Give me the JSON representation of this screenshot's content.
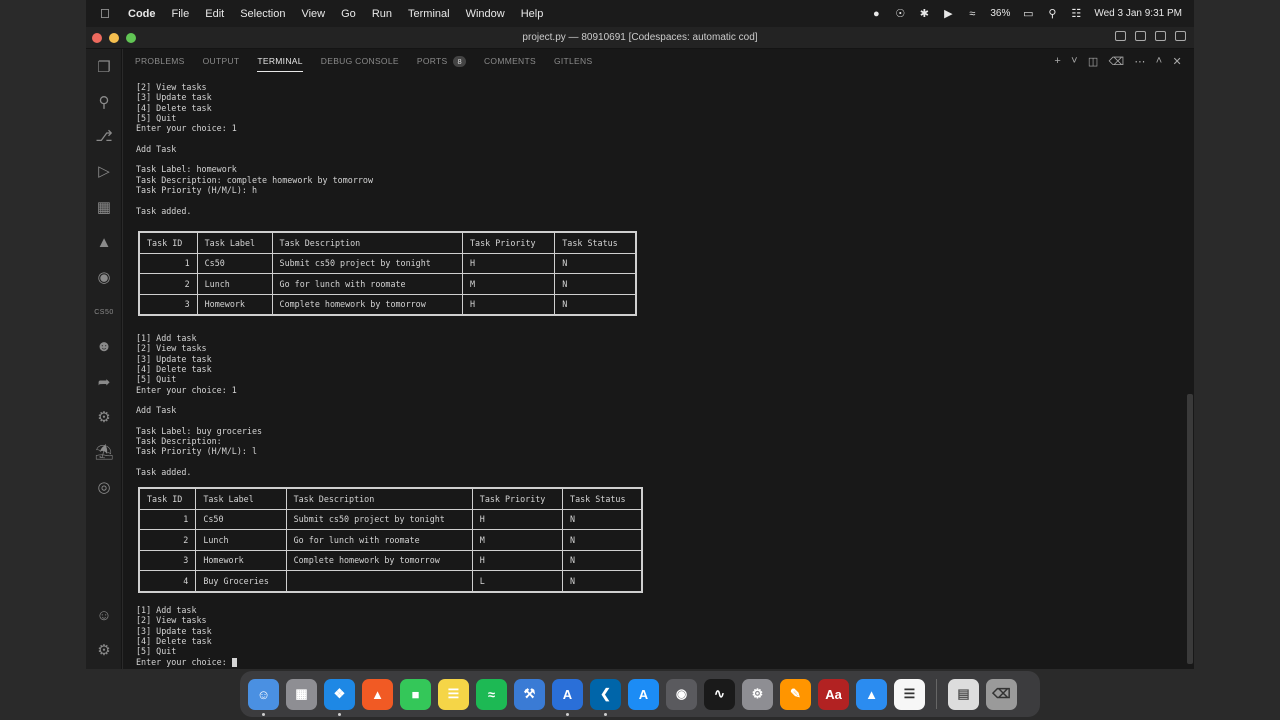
{
  "menubar": {
    "app_name": "Code",
    "menus": [
      "File",
      "Edit",
      "Selection",
      "View",
      "Go",
      "Run",
      "Terminal",
      "Window",
      "Help"
    ],
    "battery": "36%",
    "datetime": "Wed 3 Jan  9:31 PM"
  },
  "window": {
    "title": "project.py — 80910691 [Codespaces: automatic cod]"
  },
  "panel": {
    "tabs": [
      "PROBLEMS",
      "OUTPUT",
      "TERMINAL",
      "DEBUG CONSOLE",
      "PORTS",
      "COMMENTS",
      "GITLENS"
    ],
    "active_tab": "TERMINAL",
    "ports_count": "8"
  },
  "activity_bar": {
    "cs50_label": "CS50"
  },
  "terminal": {
    "block1": [
      "[2] View tasks",
      "[3] Update task",
      "[4] Delete task",
      "[5] Quit",
      "Enter your choice: 1",
      "",
      "Add Task",
      "",
      "Task Label: homework",
      "Task Description: complete homework by tomorrow",
      "Task Priority (H/M/L): h",
      "",
      "Task added."
    ],
    "block2": [
      "[1] Add task",
      "[2] View tasks",
      "[3] Update task",
      "[4] Delete task",
      "[5] Quit",
      "Enter your choice: 1",
      "",
      "Add Task",
      "",
      "Task Label: buy groceries",
      "Task Description:",
      "Task Priority (H/M/L): l",
      "",
      "Task added."
    ],
    "block3": [
      "[1] Add task",
      "[2] View tasks",
      "[3] Update task",
      "[4] Delete task",
      "[5] Quit"
    ],
    "prompt": "Enter your choice: ",
    "table_headers": [
      "Task ID",
      "Task Label",
      "Task Description",
      "Task Priority",
      "Task Status"
    ],
    "table1_rows": [
      [
        "1",
        "Cs50",
        "Submit cs50 project by tonight",
        "H",
        "N"
      ],
      [
        "2",
        "Lunch",
        "Go for lunch with roomate",
        "M",
        "N"
      ],
      [
        "3",
        "Homework",
        "Complete homework by tomorrow",
        "H",
        "N"
      ]
    ],
    "table2_rows": [
      [
        "1",
        "Cs50",
        "Submit cs50 project by tonight",
        "H",
        "N"
      ],
      [
        "2",
        "Lunch",
        "Go for lunch with roomate",
        "M",
        "N"
      ],
      [
        "3",
        "Homework",
        "Complete homework by tomorrow",
        "H",
        "N"
      ],
      [
        "4",
        "Buy Groceries",
        "",
        "L",
        "N"
      ]
    ]
  },
  "dock": {
    "dictionary_label": "Aa"
  },
  "colors": {
    "panel_bg": "#181818",
    "activity_bg": "#1f1f1f",
    "text": "#d4d4d4"
  }
}
